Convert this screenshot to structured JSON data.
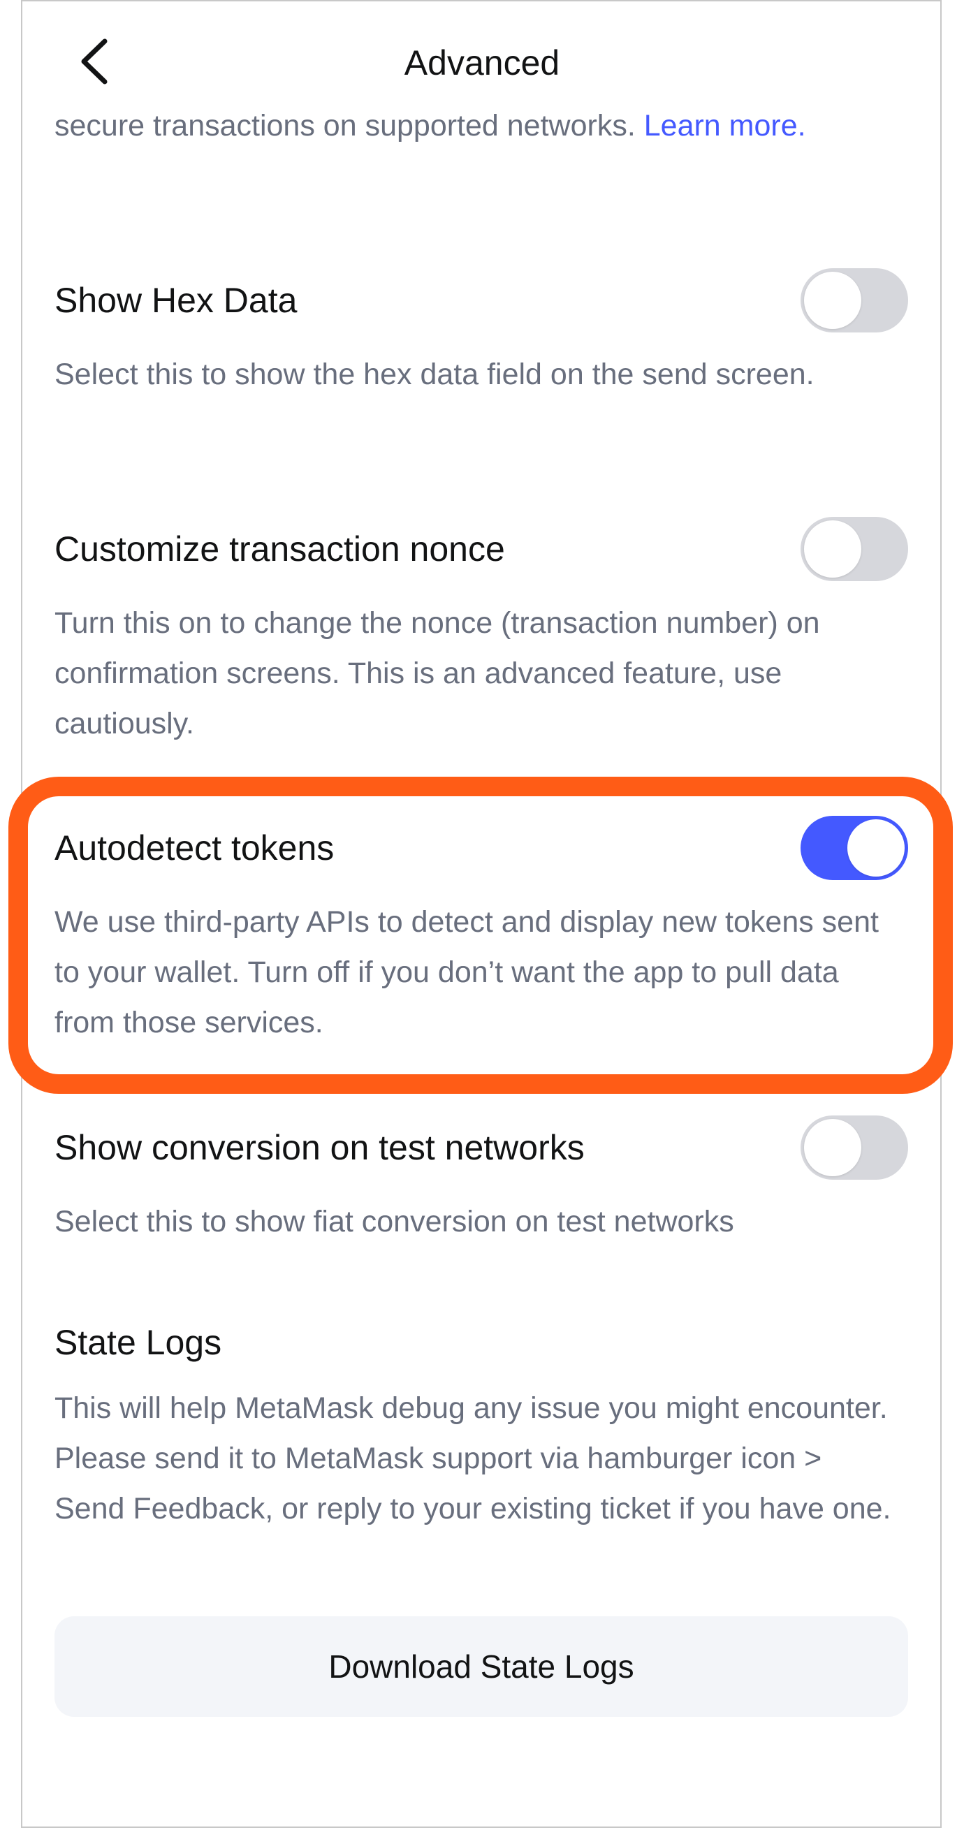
{
  "header": {
    "title": "Advanced",
    "back_icon": "chevron-left-icon"
  },
  "intro": {
    "text": "secure transactions on supported networks. ",
    "link": "Learn more."
  },
  "settings": [
    {
      "title": "Show Hex Data",
      "description": "Select this to show the hex data field on the send screen.",
      "enabled": false
    },
    {
      "title": "Customize transaction nonce",
      "description": "Turn this on to change the nonce (transaction number) on confirmation screens. This is an advanced feature, use cautiously.",
      "enabled": false
    },
    {
      "title": "Autodetect tokens",
      "description": "We use third-party APIs to detect and display new tokens sent to your wallet. Turn off if you don’t want the app to pull data from those services.",
      "enabled": true
    },
    {
      "title": "Show conversion on test networks",
      "description": "Select this to show fiat conversion on test networks",
      "enabled": false
    }
  ],
  "state_logs": {
    "title": "State Logs",
    "description": "This will help MetaMask debug any issue you might encounter. Please send it to MetaMask support via hamburger icon > Send Feedback, or reply to your existing ticket if you have one.",
    "button_label": "Download State Logs"
  },
  "colors": {
    "accent": "#4459ff",
    "highlight": "#ff5c16",
    "toggle_off": "#d6d7dc",
    "muted_text": "#686e7d",
    "button_bg": "#f3f5f9"
  }
}
